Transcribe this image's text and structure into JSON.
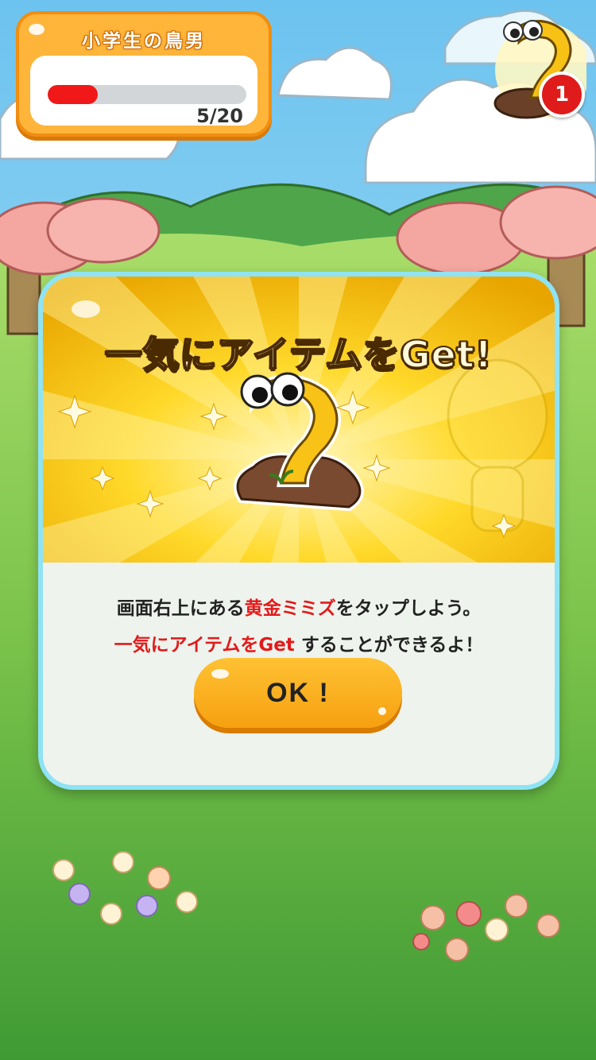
{
  "hud": {
    "title": "小学生の鳥男",
    "progress_text": "5/20",
    "progress_fraction": 0.25,
    "badge_count": "1"
  },
  "dialog": {
    "title": "一気にアイテムをGet!",
    "message_line1": {
      "before": "画面右上にある",
      "highlight": "黄金ミミズ",
      "after": "をタップしよう。"
    },
    "message_line2": {
      "highlight": "一気にアイテムをGet",
      "after": " することができるよ！"
    },
    "ok_label": "OK !"
  },
  "colors": {
    "accent_orange": "#ffb43a",
    "highlight_red": "#e21a1a",
    "dialog_border": "#8ee3f5",
    "progress_red": "#f01818"
  },
  "icons": [
    "golden-worm-icon",
    "sparkle-icon"
  ]
}
